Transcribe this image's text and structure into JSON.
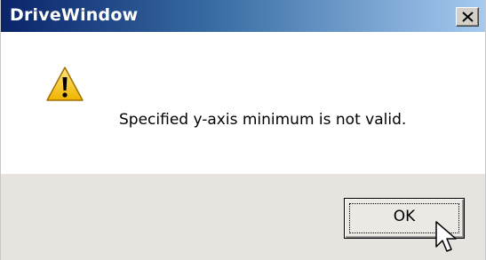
{
  "window": {
    "title": "DriveWindow",
    "close_icon": "close-icon"
  },
  "message": {
    "icon": "warning-icon",
    "text": "Specified y-axis minimum is not valid."
  },
  "buttons": {
    "ok_label": "OK"
  },
  "cursor": {
    "icon": "mouse-pointer-icon"
  },
  "colors": {
    "titlebar_start": "#0a246a",
    "titlebar_end": "#a6caf0",
    "footer_bg": "#e7e3de",
    "warning_fill": "#f5c400"
  }
}
